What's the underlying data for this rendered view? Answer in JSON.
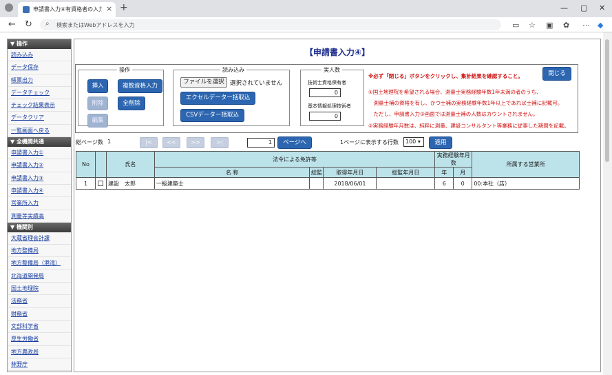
{
  "browser": {
    "tab_title": "申請書入力④有資格者の入力 -",
    "tab_close": "×",
    "new_tab": "+",
    "address_placeholder": "検索またはWebアドレスを入力",
    "win_min": "—",
    "win_max": "▢",
    "win_close": "✕"
  },
  "sidebar": {
    "sections": [
      {
        "title": "▼ 操作",
        "items": [
          "読み込み",
          "データ保存",
          "帳票出力",
          "データチェック",
          "チェック結果表示",
          "データクリア",
          "一覧画面へ戻る"
        ]
      },
      {
        "title": "▼ 全機関共通",
        "items": [
          "申請書入力①",
          "申請書入力②",
          "申請書入力③",
          "申請書入力④",
          "営業所入力",
          "測量等実績高"
        ]
      },
      {
        "title": "▼ 機関別",
        "items": [
          "大蔵省理会計課",
          "地方整備局",
          "地方整備局（港湾）",
          "北海道開発局",
          "国土地理院",
          "法務省",
          "財務省",
          "文部科学省",
          "厚生労働省",
          "地方農政局",
          "林野庁"
        ]
      }
    ]
  },
  "main": {
    "title": "【申請書入力④】",
    "ops": {
      "legend": "操作",
      "insert": "挿入",
      "multi_qual": "複数資格入力",
      "delete": "削除",
      "delete_all": "全削除",
      "edit": "編集"
    },
    "import": {
      "legend": "読み込み",
      "file_button": "ファイルを選択",
      "file_status": "選択されていません",
      "excel_import": "エクセルデーター括取込",
      "csv_import": "CSVデーター括取込"
    },
    "headcount": {
      "legend": "実人数",
      "label1": "技術士資格保有者",
      "value1": "0",
      "label2": "基本情報処理技術者",
      "value2": "0"
    },
    "notes": {
      "n1": "※必ず「閉じる」ボタンをクリックし、集計結果を確認すること。",
      "n2": "①国土地理院を希望される場合、測量士実務経験年数1年未満の者のうち、",
      "n3": "　測量士補の資格を有し、かつ士補の実務経験年数1年以上であれば士補に記載可。",
      "n4": "　ただし、申請書入力③画面では測量士補の人数はカウントされません。",
      "n5": "②実務経験年月数は、純粋に測量、建設コンサルタント等業務に従事した期間を記載。"
    },
    "close_button": "閉じる",
    "pager": {
      "total_label": "総ページ数",
      "total_value": "1",
      "first": "|<",
      "prev": "<<",
      "next": ">>",
      "last": ">|",
      "page_input": "1",
      "goto_button": "ページへ",
      "rows_label": "1ページに表示する行数",
      "rows_value": "100",
      "apply_button": "適用"
    },
    "table": {
      "h_no": "No",
      "h_name": "氏名",
      "h_license_group": "法令による免許等",
      "h_exp_group": "実務経験年月数",
      "h_office": "所属する営業所",
      "h_lic_name": "名 称",
      "h_total": "総監",
      "h_acquired": "取得年月日",
      "h_total_date": "総監年月日",
      "h_year": "年",
      "h_month": "月",
      "rows": [
        {
          "no": "1",
          "name": "建設　太郎",
          "license": "一級建築士",
          "total": "",
          "acquired": "2018/06/01",
          "total_date": "",
          "year": "6",
          "month": "0",
          "office": "00:本社（店）"
        }
      ]
    }
  }
}
